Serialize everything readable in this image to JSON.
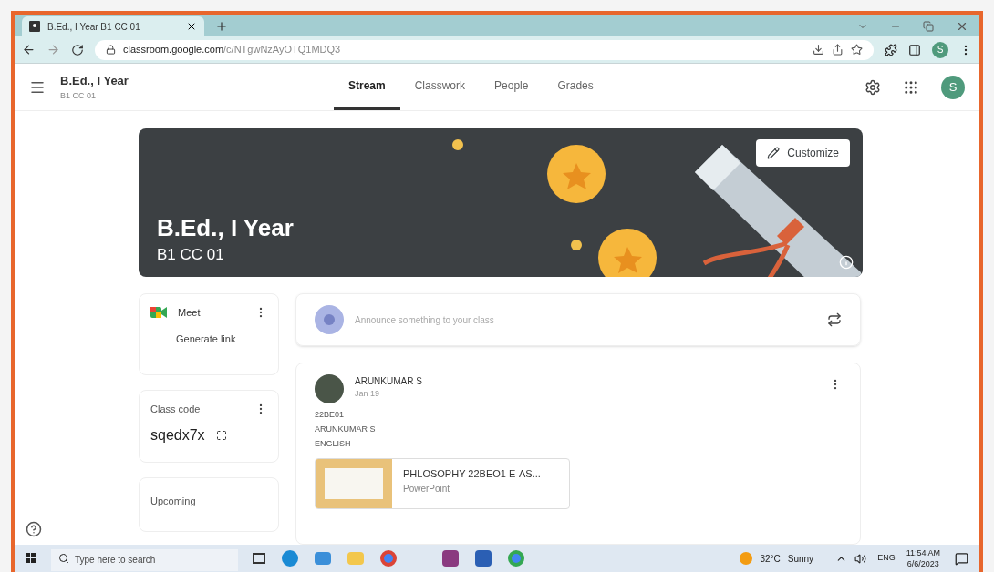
{
  "browser": {
    "tab_title": "B.Ed., I Year B1 CC 01",
    "url_host": "classroom.google.com",
    "url_path": "/c/NTgwNzAyOTQ1MDQ3",
    "profile_initial": "S"
  },
  "header": {
    "class_name": "B.Ed., I Year",
    "section": "B1 CC 01",
    "avatar_initial": "S"
  },
  "tabs": [
    {
      "label": "Stream",
      "selected": true
    },
    {
      "label": "Classwork",
      "selected": false
    },
    {
      "label": "People",
      "selected": false
    },
    {
      "label": "Grades",
      "selected": false
    }
  ],
  "banner": {
    "title": "B.Ed., I Year",
    "subtitle": "B1 CC 01",
    "customize": "Customize"
  },
  "meet": {
    "title": "Meet",
    "link": "Generate link"
  },
  "class_code": {
    "label": "Class code",
    "code": "sqedx7x"
  },
  "upcoming": {
    "title": "Upcoming"
  },
  "announce": {
    "placeholder": "Announce something to your class"
  },
  "post": {
    "author": "ARUNKUMAR S",
    "date": "Jan 19",
    "lines": [
      "22BE01",
      "ARUNKUMAR S",
      "ENGLISH"
    ],
    "attachment": {
      "title": "PHLOSOPHY 22BEO1 E-AS...",
      "type": "PowerPoint"
    }
  },
  "taskbar": {
    "search_placeholder": "Type here to search",
    "temperature": "32°C",
    "weather": "Sunny",
    "language": "ENG",
    "time": "11:54 AM",
    "date": "6/6/2023"
  }
}
